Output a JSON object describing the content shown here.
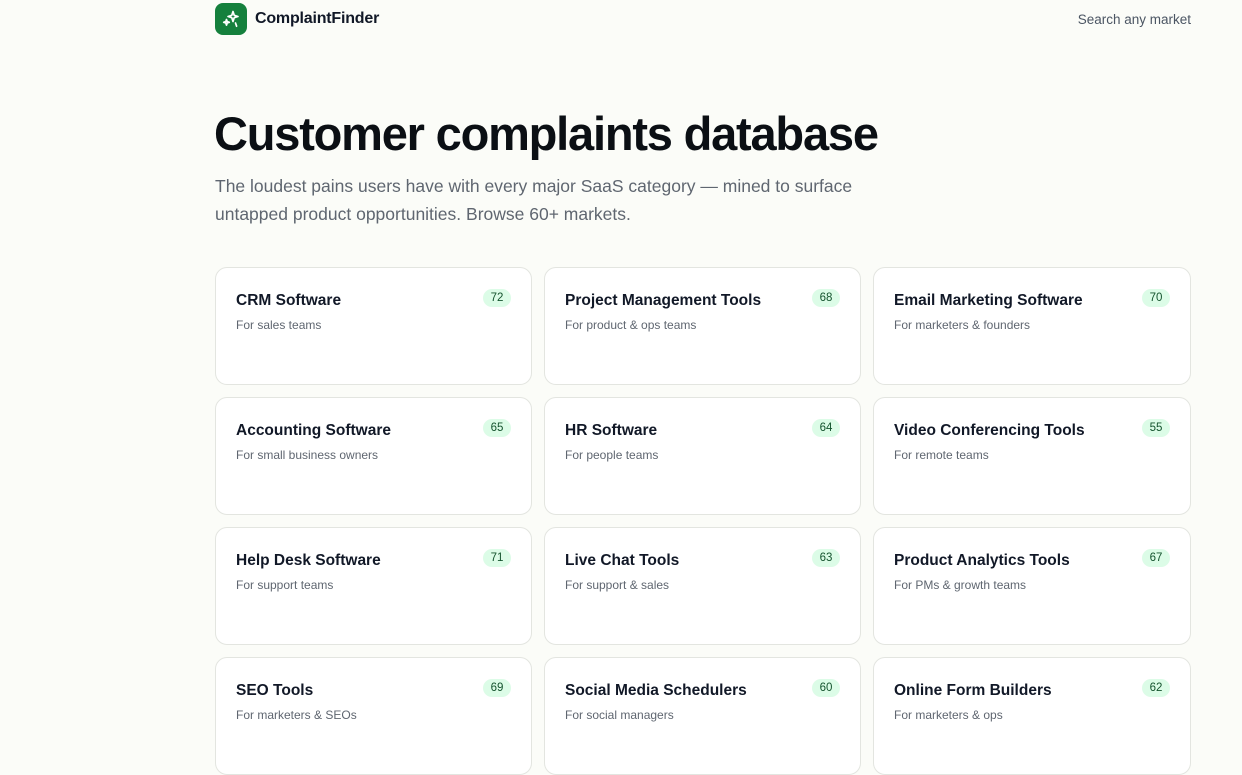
{
  "brand": {
    "name": "ComplaintFinder",
    "logo_icon": "sparkles-icon",
    "color": "#15803d"
  },
  "nav": {
    "search_label": "Search any market"
  },
  "hero": {
    "title": "Customer complaints database",
    "subtitle": "The loudest pains users have with every major SaaS category — mined to surface untapped product opportunities. Browse 60+ markets."
  },
  "markets": [
    {
      "title": "CRM Software",
      "subtitle": "For sales teams",
      "count": "72"
    },
    {
      "title": "Project Management Tools",
      "subtitle": "For product & ops teams",
      "count": "68"
    },
    {
      "title": "Email Marketing Software",
      "subtitle": "For marketers & founders",
      "count": "70"
    },
    {
      "title": "Accounting Software",
      "subtitle": "For small business owners",
      "count": "65"
    },
    {
      "title": "HR Software",
      "subtitle": "For people teams",
      "count": "64"
    },
    {
      "title": "Video Conferencing Tools",
      "subtitle": "For remote teams",
      "count": "55"
    },
    {
      "title": "Help Desk Software",
      "subtitle": "For support teams",
      "count": "71"
    },
    {
      "title": "Live Chat Tools",
      "subtitle": "For support & sales",
      "count": "63"
    },
    {
      "title": "Product Analytics Tools",
      "subtitle": "For PMs & growth teams",
      "count": "67"
    },
    {
      "title": "SEO Tools",
      "subtitle": "For marketers & SEOs",
      "count": "69"
    },
    {
      "title": "Social Media Schedulers",
      "subtitle": "For social managers",
      "count": "60"
    },
    {
      "title": "Online Form Builders",
      "subtitle": "For marketers & ops",
      "count": "62"
    }
  ]
}
